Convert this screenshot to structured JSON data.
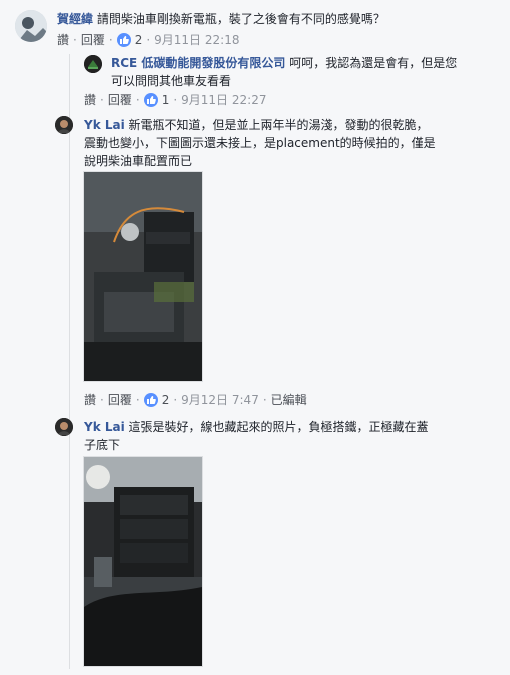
{
  "comments": [
    {
      "author": "賀經緯",
      "text": "請問柴油車剛換新電瓶，裝了之後會有不同的感覺嗎？",
      "reply": "讚",
      "reply2": "回覆",
      "likes": "2",
      "time": "9月11日 22:18"
    },
    {
      "author": "RCE 低碳動能開發股份有限公司",
      "text_line1": "呵呵，我認為還是會有，但是您",
      "text_line2": "可以問問其他車友看看",
      "reply": "讚",
      "reply2": "回覆",
      "likes": "1",
      "time": "9月11日 22:27"
    },
    {
      "author": "Yk Lai",
      "text_line1": "新電瓶不知道，但是並上兩年半的湯淺，發動的很乾脆，",
      "text_line2": "震動也變小，下圖圖示還未接上，是placement的時候拍的，僅是",
      "text_line3": "說明柴油車配置而已",
      "reply": "讚",
      "reply2": "回覆",
      "likes": "2",
      "time": "9月12日 7:47",
      "edited": "已編輯"
    },
    {
      "author": "Yk Lai",
      "text_line1": "這張是裝好，線也藏起來的照片，負極搭鐵，正極藏在蓋",
      "text_line2": "子底下"
    }
  ],
  "icons": {
    "like": "like-icon"
  },
  "colors": {
    "author": "#365899",
    "like_badge": "#5890ff",
    "meta": "#90949c"
  }
}
